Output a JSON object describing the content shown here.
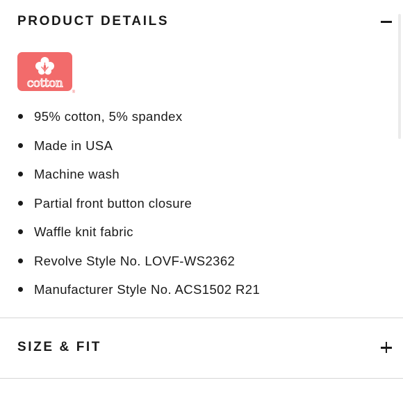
{
  "product_details": {
    "title": "PRODUCT DETAILS",
    "toggle_icon": "minus-icon",
    "logo": {
      "icon": "cotton-logo",
      "text": "cotton",
      "color": "#f26b6b",
      "registered": "®"
    },
    "items": [
      "95% cotton, 5% spandex",
      "Made in USA",
      "Machine wash",
      "Partial front button closure",
      "Waffle knit fabric",
      "Revolve Style No. LOVF-WS2362",
      "Manufacturer Style No. ACS1502 R21"
    ]
  },
  "size_fit": {
    "title": "SIZE & FIT",
    "toggle_icon": "plus-icon"
  },
  "colors": {
    "text": "#1a1a1a",
    "divider": "#d6d6d6",
    "logo": "#f26b6b"
  }
}
